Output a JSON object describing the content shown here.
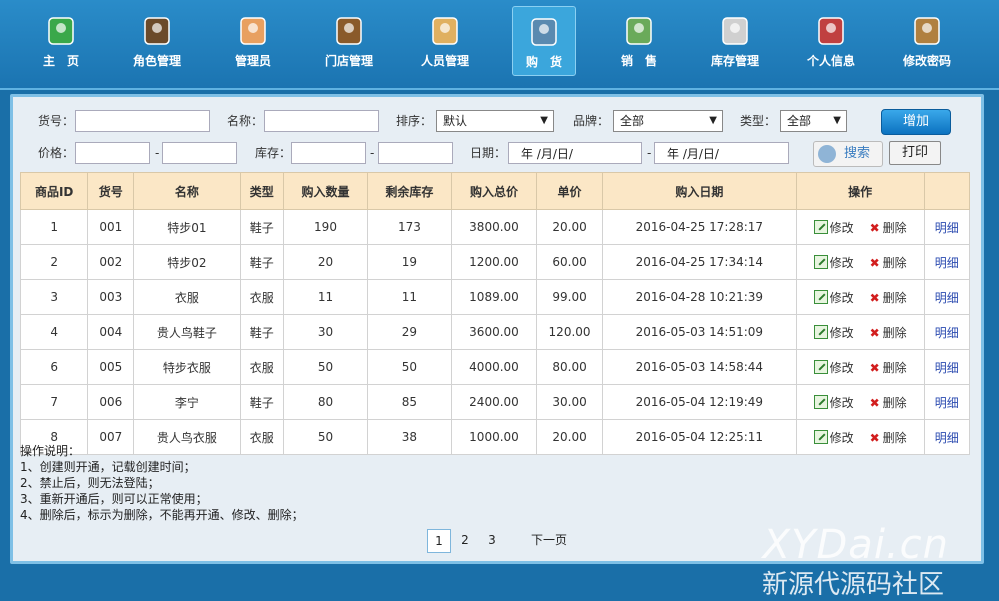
{
  "nav": [
    {
      "label": "主　页",
      "icon": "home-icon"
    },
    {
      "label": "角色管理",
      "icon": "role-icon"
    },
    {
      "label": "管理员",
      "icon": "admin-icon"
    },
    {
      "label": "门店管理",
      "icon": "store-icon"
    },
    {
      "label": "人员管理",
      "icon": "staff-icon"
    },
    {
      "label": "购　货",
      "icon": "purchase-icon",
      "active": true
    },
    {
      "label": "销　售",
      "icon": "sales-icon"
    },
    {
      "label": "库存管理",
      "icon": "inventory-icon"
    },
    {
      "label": "个人信息",
      "icon": "profile-icon"
    },
    {
      "label": "修改密码",
      "icon": "password-icon"
    }
  ],
  "filters": {
    "code_label": "货号：",
    "name_label": "名称：",
    "sort_label": "排序：",
    "sort_value": "默认",
    "brand_label": "品牌：",
    "brand_value": "全部",
    "type_label": "类型：",
    "type_value": "全部",
    "price_label": "价格：",
    "stock_label": "库存：",
    "dash": "-",
    "date_label": "日期：",
    "date_start": "年 /月/日/",
    "date_end": "年 /月/日/",
    "add_button": "增加",
    "search_button": "搜索",
    "print_button": "打印"
  },
  "table": {
    "headers": [
      "商品ID",
      "货号",
      "名称",
      "类型",
      "购入数量",
      "剩余库存",
      "购入总价",
      "单价",
      "购入日期",
      "操作",
      ""
    ],
    "edit_label": "修改",
    "delete_label": "删除",
    "detail_label": "明细",
    "rows": [
      [
        "1",
        "001",
        "特步01",
        "鞋子",
        "190",
        "173",
        "3800.00",
        "20.00",
        "2016-04-25 17:28:17"
      ],
      [
        "2",
        "002",
        "特步02",
        "鞋子",
        "20",
        "19",
        "1200.00",
        "60.00",
        "2016-04-25 17:34:14"
      ],
      [
        "3",
        "003",
        "衣服",
        "衣服",
        "11",
        "11",
        "1089.00",
        "99.00",
        "2016-04-28 10:21:39"
      ],
      [
        "4",
        "004",
        "贵人鸟鞋子",
        "鞋子",
        "30",
        "29",
        "3600.00",
        "120.00",
        "2016-05-03 14:51:09"
      ],
      [
        "6",
        "005",
        "特步衣服",
        "衣服",
        "50",
        "50",
        "4000.00",
        "80.00",
        "2016-05-03 14:58:44"
      ],
      [
        "7",
        "006",
        "李宁",
        "鞋子",
        "80",
        "85",
        "2400.00",
        "30.00",
        "2016-05-04 12:19:49"
      ],
      [
        "8",
        "007",
        "贵人鸟衣服",
        "衣服",
        "50",
        "38",
        "1000.00",
        "20.00",
        "2016-05-04 12:25:11"
      ]
    ]
  },
  "notes": [
    "操作说明：",
    "1、创建则开通，记载创建时间；",
    "2、禁止后，则无法登陆；",
    "3、重新开通后，则可以正常使用；",
    "4、删除后，标示为删除，不能再开通、修改、删除；"
  ],
  "pager": {
    "pages": [
      "1",
      "2",
      "3"
    ],
    "current": "1",
    "next": "下一页"
  },
  "watermark": {
    "line1": "XYDai.cn",
    "line2": "新源代源码社区"
  }
}
